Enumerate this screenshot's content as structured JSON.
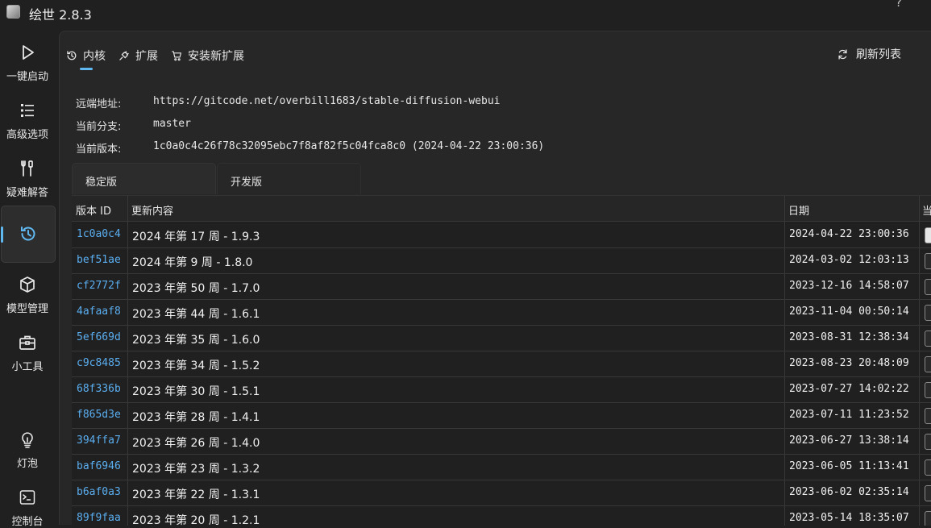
{
  "window": {
    "title": "绘世 2.8.3",
    "help": "?"
  },
  "sidebar": {
    "items": [
      {
        "label": "一键启动",
        "icon": "play-icon"
      },
      {
        "label": "高级选项",
        "icon": "list-icon"
      },
      {
        "label": "疑难解答",
        "icon": "tools-icon"
      },
      {
        "label": "",
        "icon": "history-icon",
        "active": true
      },
      {
        "label": "模型管理",
        "icon": "cube-icon"
      },
      {
        "label": "小工具",
        "icon": "toolbox-icon"
      },
      {
        "label": "灯泡",
        "icon": "lightbulb-icon"
      },
      {
        "label": "控制台",
        "icon": "console-icon"
      }
    ]
  },
  "tabs": [
    {
      "label": "内核",
      "icon": "history-icon",
      "active": true
    },
    {
      "label": "扩展",
      "icon": "plug-icon"
    },
    {
      "label": "安装新扩展",
      "icon": "cart-icon"
    }
  ],
  "refresh_label": "刷新列表",
  "info": {
    "remote_label": "远端地址:",
    "remote_value": "https://gitcode.net/overbill1683/stable-diffusion-webui",
    "branch_label": "当前分支:",
    "branch_value": "master",
    "version_label": "当前版本:",
    "version_value": "1c0a0c4c26f78c32095ebc7f8af82f5c04fca8c0 (2024-04-22 23:00:36)"
  },
  "branch_tabs": [
    {
      "label": "稳定版",
      "active": true
    },
    {
      "label": "开发版"
    }
  ],
  "table": {
    "headers": [
      "版本 ID",
      "更新内容",
      "日期",
      "当"
    ],
    "rows": [
      {
        "id": "1c0a0c4",
        "content": "2024 年第 17 周 - 1.9.3",
        "date": "2024-04-22 23:00:36",
        "current": true
      },
      {
        "id": "bef51ae",
        "content": "2024 年第 9 周 - 1.8.0",
        "date": "2024-03-02 12:03:13"
      },
      {
        "id": "cf2772f",
        "content": "2023 年第 50 周 - 1.7.0",
        "date": "2023-12-16 14:58:07"
      },
      {
        "id": "4afaaf8",
        "content": "2023 年第 44 周 - 1.6.1",
        "date": "2023-11-04 00:50:14"
      },
      {
        "id": "5ef669d",
        "content": "2023 年第 35 周 - 1.6.0",
        "date": "2023-08-31 12:38:34"
      },
      {
        "id": "c9c8485",
        "content": "2023 年第 34 周 - 1.5.2",
        "date": "2023-08-23 20:48:09"
      },
      {
        "id": "68f336b",
        "content": "2023 年第 30 周 - 1.5.1",
        "date": "2023-07-27 14:02:22"
      },
      {
        "id": "f865d3e",
        "content": "2023 年第 28 周 - 1.4.1",
        "date": "2023-07-11 11:23:52"
      },
      {
        "id": "394ffa7",
        "content": "2023 年第 26 周 - 1.4.0",
        "date": "2023-06-27 13:38:14"
      },
      {
        "id": "baf6946",
        "content": "2023 年第 23 周 - 1.3.2",
        "date": "2023-06-05 11:13:41"
      },
      {
        "id": "b6af0a3",
        "content": "2023 年第 22 周 - 1.3.1",
        "date": "2023-06-02 02:35:14"
      },
      {
        "id": "89f9faa",
        "content": "2023 年第 20 周 - 1.2.1",
        "date": "2023-05-14 18:35:07"
      }
    ]
  },
  "colors": {
    "accent": "#60b8f0",
    "id_link": "#5aaef0",
    "panel": "#272727",
    "background": "#202020"
  }
}
